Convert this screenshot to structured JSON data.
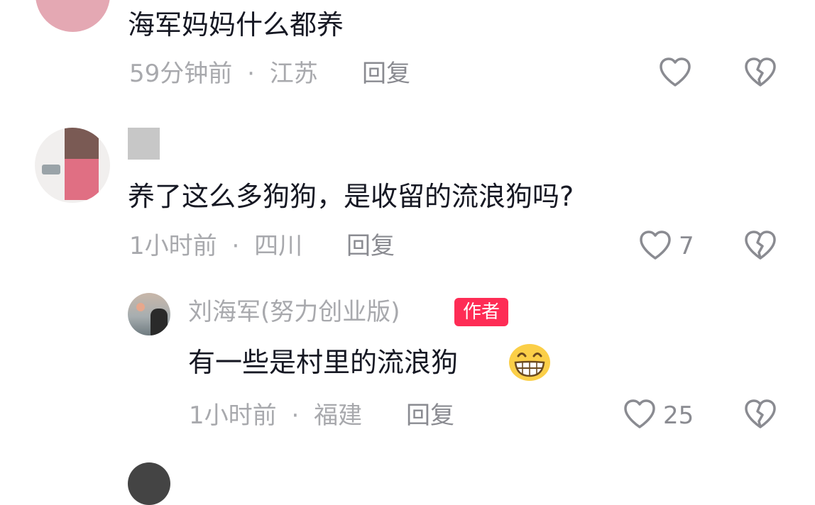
{
  "comments": [
    {
      "text": "海军妈妈什么都养",
      "time": "59分钟前",
      "location": "江苏",
      "reply_label": "回复",
      "likes": ""
    },
    {
      "text": "养了这么多狗狗，是收留的流浪狗吗?",
      "time": "1小时前",
      "location": "四川",
      "reply_label": "回复",
      "likes": "7"
    },
    {
      "author": "刘海军(努力创业版)",
      "author_badge": "作者",
      "text": "有一些是村里的流浪狗",
      "time": "1小时前",
      "location": "福建",
      "reply_label": "回复",
      "likes": "25"
    }
  ],
  "separator": "·",
  "icons": {
    "like": "heart-outline-icon",
    "dislike": "broken-heart-icon",
    "emoji": "grinning-face-emoji-icon"
  },
  "colors": {
    "text": "#161823",
    "meta": "#a8a9ad",
    "badge": "#fe2c55"
  }
}
